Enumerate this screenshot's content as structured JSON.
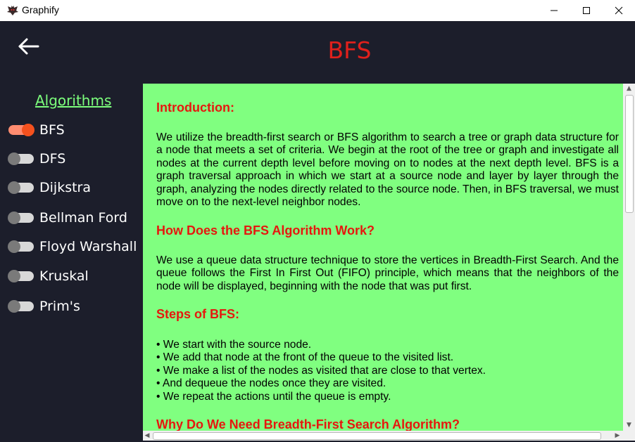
{
  "window": {
    "title": "Graphify",
    "icon": "bat-icon"
  },
  "header": {
    "title": "BFS",
    "back_icon": "arrow-left-icon"
  },
  "sidebar": {
    "heading": "Algorithms",
    "items": [
      {
        "label": "BFS",
        "enabled": true
      },
      {
        "label": "DFS",
        "enabled": false
      },
      {
        "label": "Dijkstra",
        "enabled": false
      },
      {
        "label": "Bellman Ford",
        "enabled": false
      },
      {
        "label": "Floyd Warshall",
        "enabled": false
      },
      {
        "label": "Kruskal",
        "enabled": false
      },
      {
        "label": "Prim's",
        "enabled": false
      }
    ]
  },
  "content": {
    "sections": [
      {
        "heading": "Introduction:",
        "text": "We utilize the breadth-first search or BFS algorithm to search a tree or graph data structure for a node that meets a set of criteria. We begin at the root of the tree or graph and investigate all nodes at the current depth level before moving on to nodes at the next depth level. BFS is a graph traversal approach in which we start at a source node and layer by layer through the graph, analyzing the nodes directly related to the source node. Then, in BFS traversal, we must move on to the next-level neighbor nodes."
      },
      {
        "heading": "How Does the BFS Algorithm Work?",
        "text": "We use a queue data structure technique to store the vertices in Breadth-First Search. And the queue follows the First In First Out (FIFO) principle, which means that the neighbors of the node will be displayed, beginning with the node that was put first."
      },
      {
        "heading": "Steps of BFS:",
        "bullets": [
          "• We start with the source node.",
          "• We add that node at the front of the queue to the visited list.",
          "• We make a list of the nodes as visited that are close to that vertex.",
          "• And dequeue the nodes once they are visited.",
          "• We repeat the actions until the queue is empty."
        ]
      },
      {
        "heading": "Why Do We Need Breadth-First Search Algorithm?"
      }
    ]
  },
  "colors": {
    "background": "#1c1e2b",
    "title": "#e0201c",
    "heading_link": "#7cff7c",
    "content_bg": "#80ff80",
    "section_heading": "#e6170e",
    "toggle_on": "#f4511e"
  }
}
